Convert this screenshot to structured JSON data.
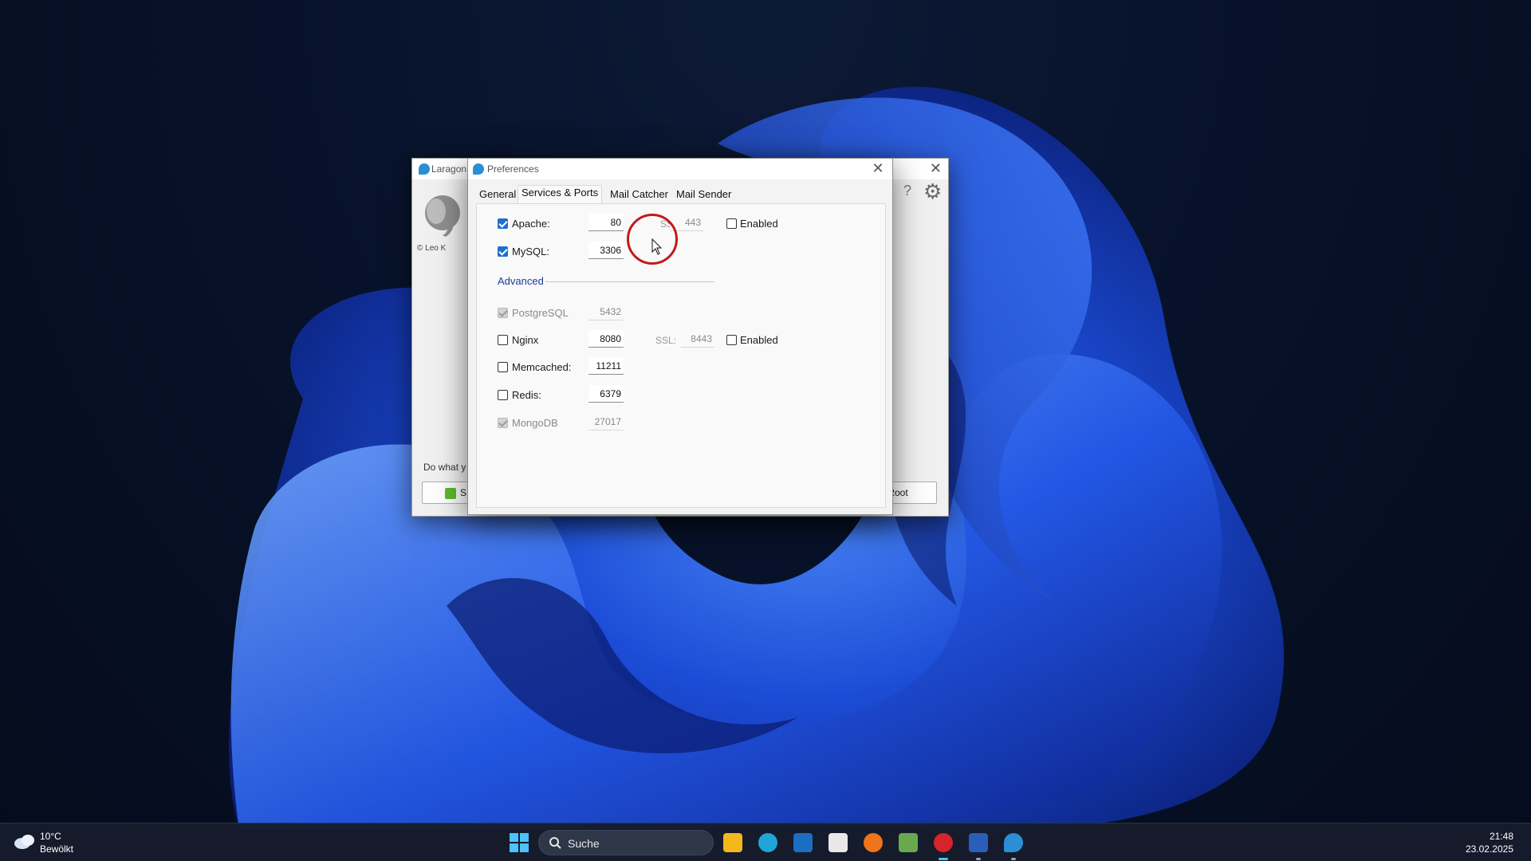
{
  "laragon": {
    "title": "Laragon",
    "copyright": "© Leo K",
    "help_glyph": "?",
    "gear_glyph": "⚙",
    "prompt": "Do what y",
    "start_label": "S",
    "root_label": "Root",
    "close_glyph": "✕"
  },
  "preferences": {
    "title": "Preferences",
    "close_glyph": "✕",
    "tabs": [
      {
        "label": "General"
      },
      {
        "label": "Services & Ports"
      },
      {
        "label": "Mail Catcher"
      },
      {
        "label": "Mail Sender"
      }
    ],
    "active_tab": "Services & Ports",
    "services": {
      "apache": {
        "label": "Apache:",
        "checked": true,
        "port": "80",
        "ssl_label": "SSL:",
        "ssl_port": "443",
        "ssl_enabled_label": "Enabled",
        "ssl_enabled": false
      },
      "mysql": {
        "label": "MySQL:",
        "checked": true,
        "port": "3306"
      }
    },
    "advanced_label": "Advanced",
    "advanced": {
      "postgresql": {
        "label": "PostgreSQL",
        "checked": true,
        "disabled": true,
        "port": "5432"
      },
      "nginx": {
        "label": "Nginx",
        "checked": false,
        "port": "8080",
        "ssl_label": "SSL:",
        "ssl_port": "8443",
        "ssl_enabled_label": "Enabled",
        "ssl_enabled": false
      },
      "memcached": {
        "label": "Memcached:",
        "checked": false,
        "port": "11211"
      },
      "redis": {
        "label": "Redis:",
        "checked": false,
        "port": "6379"
      },
      "mongodb": {
        "label": "MongoDB",
        "checked": true,
        "disabled": true,
        "port": "27017"
      }
    }
  },
  "taskbar": {
    "weather_temp": "10°C",
    "weather_desc": "Bewölkt",
    "search_placeholder": "Suche",
    "apps": [
      {
        "name": "file-explorer",
        "color": "#f2b81b"
      },
      {
        "name": "edge",
        "color": "#1fa6d6"
      },
      {
        "name": "outlook",
        "color": "#1b6ec2"
      },
      {
        "name": "microsoft-store",
        "color": "#e8e8e8"
      },
      {
        "name": "orange-app",
        "color": "#f0741b"
      },
      {
        "name": "notepad-app",
        "color": "#6aa84f"
      },
      {
        "name": "red-app",
        "color": "#d6242a"
      },
      {
        "name": "word",
        "color": "#2b5eb8"
      },
      {
        "name": "laragon",
        "color": "#2b8fd6"
      }
    ],
    "clock_time": "21:48",
    "clock_date": "23.02.2025"
  },
  "colors": {
    "accent": "#1f6fd1",
    "click_ring": "#c21a1a",
    "advanced_link": "#1a3c9e"
  }
}
